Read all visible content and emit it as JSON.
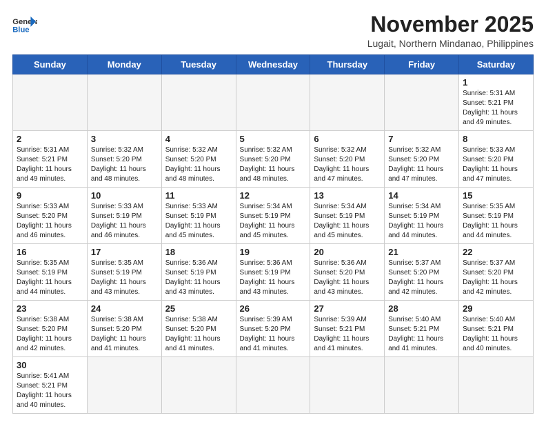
{
  "header": {
    "logo_general": "General",
    "logo_blue": "Blue",
    "month_title": "November 2025",
    "location": "Lugait, Northern Mindanao, Philippines"
  },
  "weekdays": [
    "Sunday",
    "Monday",
    "Tuesday",
    "Wednesday",
    "Thursday",
    "Friday",
    "Saturday"
  ],
  "weeks": [
    [
      {
        "day": "",
        "info": ""
      },
      {
        "day": "",
        "info": ""
      },
      {
        "day": "",
        "info": ""
      },
      {
        "day": "",
        "info": ""
      },
      {
        "day": "",
        "info": ""
      },
      {
        "day": "",
        "info": ""
      },
      {
        "day": "1",
        "info": "Sunrise: 5:31 AM\nSunset: 5:21 PM\nDaylight: 11 hours\nand 49 minutes."
      }
    ],
    [
      {
        "day": "2",
        "info": "Sunrise: 5:31 AM\nSunset: 5:21 PM\nDaylight: 11 hours\nand 49 minutes."
      },
      {
        "day": "3",
        "info": "Sunrise: 5:32 AM\nSunset: 5:20 PM\nDaylight: 11 hours\nand 48 minutes."
      },
      {
        "day": "4",
        "info": "Sunrise: 5:32 AM\nSunset: 5:20 PM\nDaylight: 11 hours\nand 48 minutes."
      },
      {
        "day": "5",
        "info": "Sunrise: 5:32 AM\nSunset: 5:20 PM\nDaylight: 11 hours\nand 48 minutes."
      },
      {
        "day": "6",
        "info": "Sunrise: 5:32 AM\nSunset: 5:20 PM\nDaylight: 11 hours\nand 47 minutes."
      },
      {
        "day": "7",
        "info": "Sunrise: 5:32 AM\nSunset: 5:20 PM\nDaylight: 11 hours\nand 47 minutes."
      },
      {
        "day": "8",
        "info": "Sunrise: 5:33 AM\nSunset: 5:20 PM\nDaylight: 11 hours\nand 47 minutes."
      }
    ],
    [
      {
        "day": "9",
        "info": "Sunrise: 5:33 AM\nSunset: 5:20 PM\nDaylight: 11 hours\nand 46 minutes."
      },
      {
        "day": "10",
        "info": "Sunrise: 5:33 AM\nSunset: 5:19 PM\nDaylight: 11 hours\nand 46 minutes."
      },
      {
        "day": "11",
        "info": "Sunrise: 5:33 AM\nSunset: 5:19 PM\nDaylight: 11 hours\nand 45 minutes."
      },
      {
        "day": "12",
        "info": "Sunrise: 5:34 AM\nSunset: 5:19 PM\nDaylight: 11 hours\nand 45 minutes."
      },
      {
        "day": "13",
        "info": "Sunrise: 5:34 AM\nSunset: 5:19 PM\nDaylight: 11 hours\nand 45 minutes."
      },
      {
        "day": "14",
        "info": "Sunrise: 5:34 AM\nSunset: 5:19 PM\nDaylight: 11 hours\nand 44 minutes."
      },
      {
        "day": "15",
        "info": "Sunrise: 5:35 AM\nSunset: 5:19 PM\nDaylight: 11 hours\nand 44 minutes."
      }
    ],
    [
      {
        "day": "16",
        "info": "Sunrise: 5:35 AM\nSunset: 5:19 PM\nDaylight: 11 hours\nand 44 minutes."
      },
      {
        "day": "17",
        "info": "Sunrise: 5:35 AM\nSunset: 5:19 PM\nDaylight: 11 hours\nand 43 minutes."
      },
      {
        "day": "18",
        "info": "Sunrise: 5:36 AM\nSunset: 5:19 PM\nDaylight: 11 hours\nand 43 minutes."
      },
      {
        "day": "19",
        "info": "Sunrise: 5:36 AM\nSunset: 5:19 PM\nDaylight: 11 hours\nand 43 minutes."
      },
      {
        "day": "20",
        "info": "Sunrise: 5:36 AM\nSunset: 5:20 PM\nDaylight: 11 hours\nand 43 minutes."
      },
      {
        "day": "21",
        "info": "Sunrise: 5:37 AM\nSunset: 5:20 PM\nDaylight: 11 hours\nand 42 minutes."
      },
      {
        "day": "22",
        "info": "Sunrise: 5:37 AM\nSunset: 5:20 PM\nDaylight: 11 hours\nand 42 minutes."
      }
    ],
    [
      {
        "day": "23",
        "info": "Sunrise: 5:38 AM\nSunset: 5:20 PM\nDaylight: 11 hours\nand 42 minutes."
      },
      {
        "day": "24",
        "info": "Sunrise: 5:38 AM\nSunset: 5:20 PM\nDaylight: 11 hours\nand 41 minutes."
      },
      {
        "day": "25",
        "info": "Sunrise: 5:38 AM\nSunset: 5:20 PM\nDaylight: 11 hours\nand 41 minutes."
      },
      {
        "day": "26",
        "info": "Sunrise: 5:39 AM\nSunset: 5:20 PM\nDaylight: 11 hours\nand 41 minutes."
      },
      {
        "day": "27",
        "info": "Sunrise: 5:39 AM\nSunset: 5:21 PM\nDaylight: 11 hours\nand 41 minutes."
      },
      {
        "day": "28",
        "info": "Sunrise: 5:40 AM\nSunset: 5:21 PM\nDaylight: 11 hours\nand 41 minutes."
      },
      {
        "day": "29",
        "info": "Sunrise: 5:40 AM\nSunset: 5:21 PM\nDaylight: 11 hours\nand 40 minutes."
      }
    ],
    [
      {
        "day": "30",
        "info": "Sunrise: 5:41 AM\nSunset: 5:21 PM\nDaylight: 11 hours\nand 40 minutes."
      },
      {
        "day": "",
        "info": ""
      },
      {
        "day": "",
        "info": ""
      },
      {
        "day": "",
        "info": ""
      },
      {
        "day": "",
        "info": ""
      },
      {
        "day": "",
        "info": ""
      },
      {
        "day": "",
        "info": ""
      }
    ]
  ]
}
